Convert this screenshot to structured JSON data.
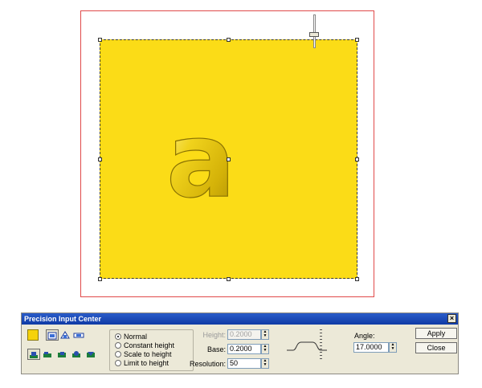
{
  "dialog": {
    "title": "Precision Input Center",
    "close_label": "×",
    "modes": [
      {
        "label": "Normal",
        "selected": true
      },
      {
        "label": "Constant height",
        "selected": false
      },
      {
        "label": "Scale to height",
        "selected": false
      },
      {
        "label": "Limit to height",
        "selected": false
      }
    ],
    "height": {
      "label": "Height:",
      "value": "0.2000",
      "enabled": false
    },
    "base": {
      "label": "Base:",
      "value": "0.2000"
    },
    "resolution": {
      "label": "Resolution:",
      "value": "50"
    },
    "angle": {
      "label": "Angle:",
      "value": "17.0000"
    },
    "apply_label": "Apply",
    "close_button_label": "Close",
    "color_swatch": "#f5d20a"
  },
  "canvas": {
    "relief_color": "#fbdc17",
    "letter": "a",
    "page_border_color": "#e04a4a"
  }
}
